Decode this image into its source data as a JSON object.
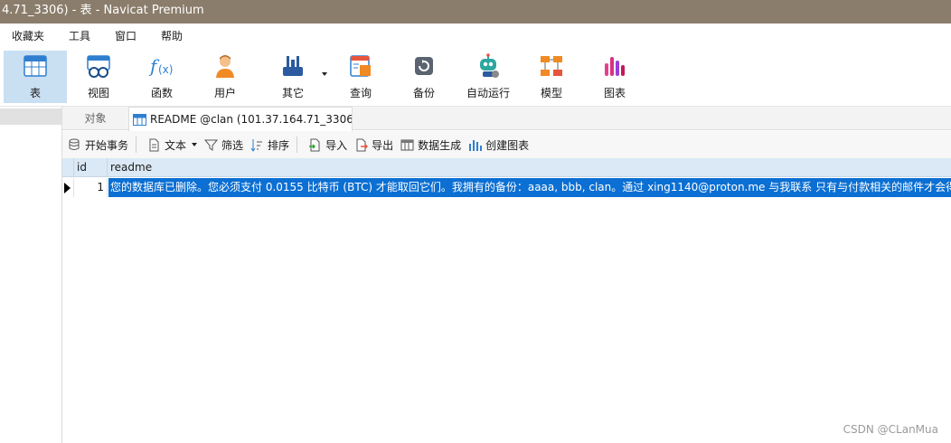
{
  "window": {
    "title": "4.71_3306) - 表 - Navicat Premium"
  },
  "menu": [
    "收藏夹",
    "工具",
    "窗口",
    "帮助"
  ],
  "toolbar": [
    {
      "label": "表",
      "icon": "table-icon",
      "active": true
    },
    {
      "label": "视图",
      "icon": "view-icon"
    },
    {
      "label": "函数",
      "icon": "function-icon"
    },
    {
      "label": "用户",
      "icon": "user-icon"
    },
    {
      "label": "其它",
      "icon": "tools-icon"
    },
    {
      "label": "查询",
      "icon": "query-icon"
    },
    {
      "label": "备份",
      "icon": "backup-icon"
    },
    {
      "label": "自动运行",
      "icon": "robot-icon"
    },
    {
      "label": "模型",
      "icon": "model-icon"
    },
    {
      "label": "图表",
      "icon": "chart-icon"
    }
  ],
  "tabs": {
    "objects": "对象",
    "readme": "README @clan (101.37.164.71_3306..."
  },
  "actions": {
    "begin_transaction": "开始事务",
    "text": "文本",
    "filter": "筛选",
    "sort": "排序",
    "import": "导入",
    "export": "导出",
    "generate_data": "数据生成",
    "create_chart": "创建图表"
  },
  "grid": {
    "columns": [
      "id",
      "readme"
    ],
    "rows": [
      {
        "id": "1",
        "readme": "您的数据库已删除。您必须支付 0.0155 比特币 (BTC) 才能取回它们。我拥有的备份：aaaa, bbb, clan。通过 xing1140@proton.me 与我联系 只有与付款相关的邮件才会得到回复"
      }
    ]
  },
  "watermark": "CSDN @CLanMua",
  "colors": {
    "titlebar": "#8b7d6b",
    "selection": "#0b6fd3",
    "active_tool": "#c9dff2",
    "header": "#dbe9f6"
  }
}
